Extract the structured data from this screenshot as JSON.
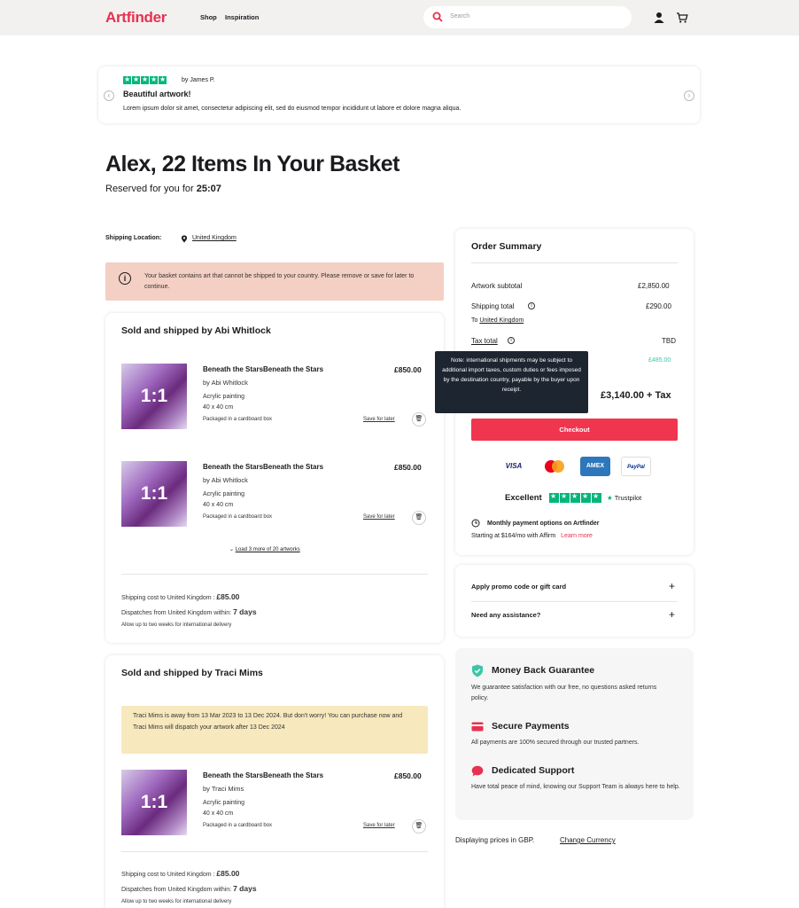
{
  "header": {
    "logo": "Artfinder",
    "nav": [
      "Shop",
      "Inspiration"
    ],
    "search_placeholder": "Search"
  },
  "review": {
    "author": "by James P.",
    "title": "Beautiful artwork!",
    "text": "Lorem ipsum dolor sit amet, consectetur adipiscing elit, sed do eiusmod tempor incididunt ut labore et dolore magna aliqua.",
    "rating": 5
  },
  "page": {
    "title": "Alex, 22 Items In Your Basket",
    "reserved_label": "Reserved for you for",
    "timer": "25:07",
    "shipping_location_label": "Shipping Location:",
    "shipping_location": "United Kingdom",
    "warning": "Your basket contains art that cannot be shipped to your country. Please remove or save for later to continue."
  },
  "seller1": {
    "label": "Sold and shipped by",
    "name": "Abi Whitlock",
    "items": [
      {
        "title": "Beneath the StarsBeneath the Stars",
        "by": "by Abi Whitlock",
        "medium": "Acrylic painting",
        "size": "40 x 40 cm",
        "packaging": "Packaged in a cardboard box",
        "price": "£850.00",
        "thumb": "1:1",
        "save": "Save for later"
      },
      {
        "title": "Beneath the StarsBeneath the Stars",
        "by": "by Abi Whitlock",
        "medium": "Acrylic painting",
        "size": "40 x 40 cm",
        "packaging": "Packaged in a cardboard box",
        "price": "£850.00",
        "thumb": "1:1",
        "save": "Save for later"
      }
    ],
    "load_more": "Load 3 more of 20 artworks",
    "shipping_cost_label": "Shipping cost to United Kingdom :",
    "shipping_cost": "£85.00",
    "dispatch_label": "Dispatches from United Kingdom within:",
    "dispatch_time": "7 days",
    "intl_note": "Allow up to two weeks for international delivery"
  },
  "seller2": {
    "label": "Sold and shipped by",
    "name": "Traci Mims",
    "away_note": "Traci Mims is away from 13 Mar 2023 to 13 Dec 2024. But don't worry! You can purchase now and Traci Mims will dispatch your artwork after 13 Dec 2024",
    "items": [
      {
        "title": "Beneath the StarsBeneath the Stars",
        "by": "by Traci Mims",
        "medium": "Acrylic painting",
        "size": "40 x 40 cm",
        "packaging": "Packaged in a cardboard box",
        "price": "£850.00",
        "thumb": "1:1",
        "save": "Save for later"
      }
    ],
    "shipping_cost_label": "Shipping cost to United Kingdom :",
    "shipping_cost": "£85.00",
    "dispatch_label": "Dispatches from United Kingdom within:",
    "dispatch_time": "7 days",
    "intl_note": "Allow up to two weeks for international delivery"
  },
  "summary": {
    "title": "Order Summary",
    "subtotal_label": "Artwork subtotal",
    "subtotal": "£2,850.00",
    "shipping_label": "Shipping total",
    "shipping": "£290.00",
    "to_label": "To",
    "to_country": "United Kingdom",
    "tax_label": "Tax total",
    "tax": "TBD",
    "discount": "£485.00",
    "total": "£3,140.00 + Tax",
    "tooltip": "Note: international shipments may be subject to additional import taxes, custom duties or fees imposed by the destination country, payable by the buyer upon receipt.",
    "checkout": "Checkout",
    "payments": [
      "VISA",
      "Mastercard",
      "AMEX",
      "PayPal"
    ],
    "trust_label": "Excellent",
    "trust_brand": "Trustpilot",
    "monthly_title": "Monthly payment options on Artfinder",
    "monthly_text": "Starting at $164/mo with Affirm",
    "learn_more": "Learn more"
  },
  "promo": {
    "promo_label": "Apply promo code or gift card",
    "assist_label": "Need any assistance?"
  },
  "guarantees": [
    {
      "title": "Money Back Guarantee",
      "text": "We guarantee satisfaction with our free, no questions asked returns policy.",
      "icon": "shield-icon",
      "color": "#3cc6a8"
    },
    {
      "title": "Secure Payments",
      "text": "All payments are 100% secured through our trusted partners.",
      "icon": "card-icon",
      "color": "#e8304f"
    },
    {
      "title": "Dedicated Support",
      "text": "Have total peace of mind, knowing our Support Team is always here to help.",
      "icon": "chat-icon",
      "color": "#e8304f"
    }
  ],
  "currency": {
    "text": "Displaying prices in GBP.",
    "link": "Change Currency"
  },
  "colors": {
    "brand": "#e8304f",
    "trustpilot": "#00b67a",
    "warning_bg": "#f4cfc3",
    "away_bg": "#f7e8bd"
  }
}
